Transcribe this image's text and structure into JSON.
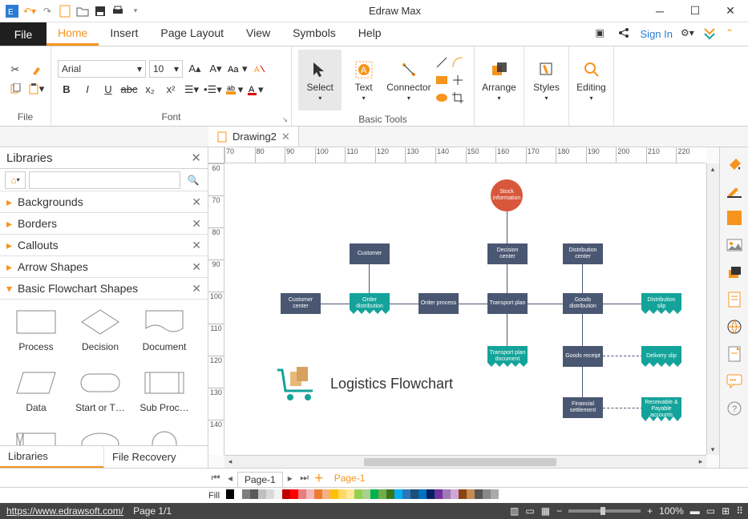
{
  "app": {
    "title": "Edraw Max"
  },
  "qat_icons": [
    "app-logo",
    "undo",
    "redo",
    "new",
    "open",
    "save",
    "print"
  ],
  "window_controls": [
    "minimize",
    "maximize",
    "close"
  ],
  "menu": {
    "file": "File",
    "tabs": [
      "Home",
      "Insert",
      "Page Layout",
      "View",
      "Symbols",
      "Help"
    ],
    "active": 0,
    "signin": "Sign In"
  },
  "ribbon": {
    "file_group": "File",
    "font_group": "Font",
    "font_name": "Arial",
    "font_size": "10",
    "basic_tools_group": "Basic Tools",
    "select": "Select",
    "text": "Text",
    "connector": "Connector",
    "arrange": "Arrange",
    "styles": "Styles",
    "editing": "Editing"
  },
  "doc": {
    "tab": "Drawing2"
  },
  "libraries": {
    "title": "Libraries",
    "categories": [
      "Backgrounds",
      "Borders",
      "Callouts",
      "Arrow Shapes",
      "Basic Flowchart Shapes"
    ],
    "shapes": [
      "Process",
      "Decision",
      "Document",
      "Data",
      "Start or T…",
      "Sub Proc…"
    ],
    "footer": [
      "Libraries",
      "File Recovery"
    ]
  },
  "ruler_h": [
    "70",
    "80",
    "90",
    "100",
    "110",
    "120",
    "130",
    "140",
    "150",
    "160",
    "170",
    "180",
    "190",
    "200",
    "210",
    "220"
  ],
  "ruler_v": [
    "60",
    "70",
    "80",
    "90",
    "100",
    "110",
    "120",
    "130",
    "140"
  ],
  "flow": {
    "title": "Logistics Flowchart",
    "stock": "Stock information",
    "customer": "Customer",
    "customer_center": "Customer center",
    "order_dist": "Order distribution",
    "order_process": "Order process",
    "decision_center": "Decision center",
    "transport_plan": "Transport plan",
    "dist_center": "Distribution center",
    "goods_dist": "Goods distribution",
    "dist_slip": "Distribution slip",
    "transport_doc": "Transport plan document",
    "goods_receipt": "Goods receipt",
    "delivery_slip": "Delivery slip",
    "financial": "Financial settlement",
    "receivable": "Receivable & Payable accounts"
  },
  "pagetabs": {
    "label": "Page-1",
    "after": "Page-1"
  },
  "fillrow": {
    "label": "Fill"
  },
  "status": {
    "url": "https://www.edrawsoft.com/",
    "page": "Page 1/1",
    "zoom": "100%"
  },
  "colors": {
    "accent": "#f7941d",
    "node_rect": "#4a5772",
    "node_banner": "#14a39a",
    "node_circle": "#d8573c"
  },
  "palette": [
    "#000",
    "#fff",
    "#7f7f7f",
    "#595959",
    "#bfbfbf",
    "#d9d9d9",
    "#f2f2f2",
    "#c00000",
    "#ff0000",
    "#e97c7c",
    "#f4b6b6",
    "#ed7d31",
    "#f4b183",
    "#ffc000",
    "#ffd966",
    "#ffe699",
    "#92d050",
    "#a9d18e",
    "#00b050",
    "#70ad47",
    "#38761d",
    "#00b0f0",
    "#2e75b6",
    "#1f4e79",
    "#0070c0",
    "#002060",
    "#7030a0",
    "#9e7bb5",
    "#d0a6d6",
    "#8b4513",
    "#c68c53",
    "#555",
    "#888",
    "#aaa"
  ]
}
